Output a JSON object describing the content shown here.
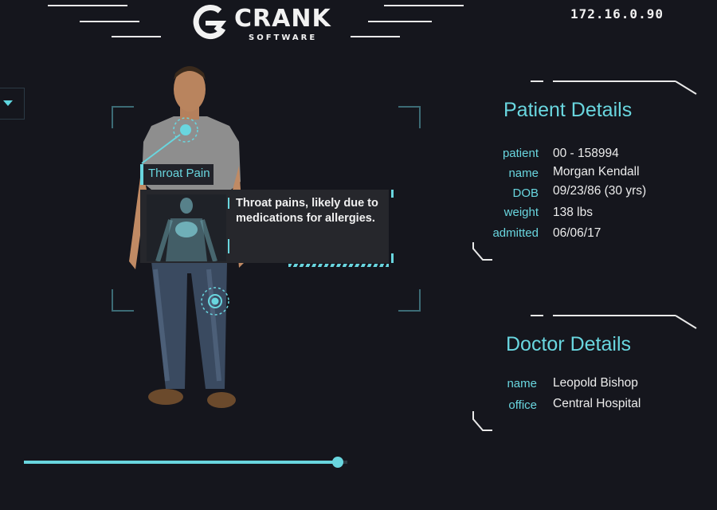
{
  "header": {
    "logo": {
      "name": "CRANK",
      "sub": "SOFTWARE"
    },
    "ip_address": "172.16.0.90"
  },
  "colors": {
    "accent": "#69d6df",
    "background": "#15161d",
    "text": "#ececec"
  },
  "tooltip": {
    "title": "Throat Pain",
    "description": "Throat pains, likely due to medications for allergies."
  },
  "patient_details": {
    "title": "Patient Details",
    "fields": [
      {
        "label": "patient",
        "value": "00 - 158994"
      },
      {
        "label": "name",
        "value": "Morgan Kendall"
      },
      {
        "label": "DOB",
        "value": "09/23/86 (30 yrs)"
      },
      {
        "label": "weight",
        "value": "138 lbs"
      },
      {
        "label": "admitted",
        "value": "06/06/17"
      }
    ]
  },
  "doctor_details": {
    "title": "Doctor Details",
    "fields": [
      {
        "label": "name",
        "value": "Leopold Bishop"
      },
      {
        "label": "office",
        "value": "Central Hospital"
      }
    ]
  },
  "slider": {
    "fraction": 0.97
  }
}
